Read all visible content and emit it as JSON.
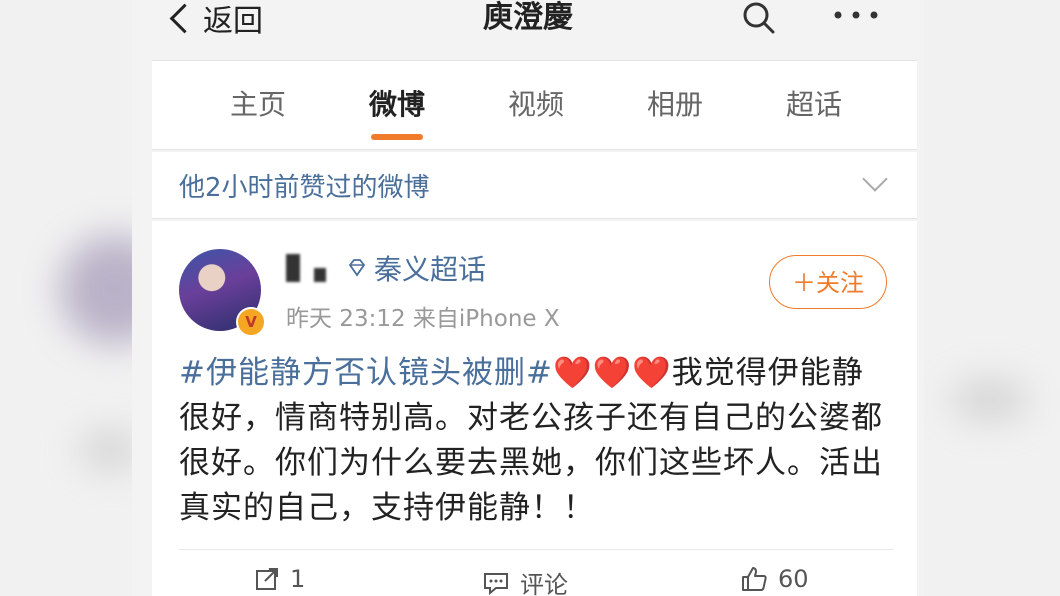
{
  "nav": {
    "back_label": "返回",
    "title": "庾澄慶",
    "search_icon": "search-icon",
    "more_icon": "more-icon"
  },
  "tabs": [
    {
      "label": "主页",
      "active": false
    },
    {
      "label": "微博",
      "active": true
    },
    {
      "label": "视频",
      "active": false
    },
    {
      "label": "相册",
      "active": false
    },
    {
      "label": "超话",
      "active": false
    }
  ],
  "liked_banner": {
    "text": "他2小时前赞过的微博",
    "icon": "chevron-down-icon"
  },
  "post": {
    "topic": "秦义超话",
    "meta": "昨天 23:12  来自iPhone X",
    "follow_label": "＋关注",
    "hashtag": "#伊能静方否认镜头被删#",
    "hearts": "❤️❤️❤️",
    "body_text": "我觉得伊能静很好，情商特别高。对老公孩子还有自己的公婆都很好。你们为什么要去黑她，你们这些坏人。活出真实的自己，支持伊能静！！",
    "actions": {
      "repost_count": "1",
      "comment_label": "评论",
      "like_count": "60"
    }
  },
  "colors": {
    "accent": "#f07b2a",
    "link": "#4a6f9b",
    "heart": "#e62a2a"
  }
}
